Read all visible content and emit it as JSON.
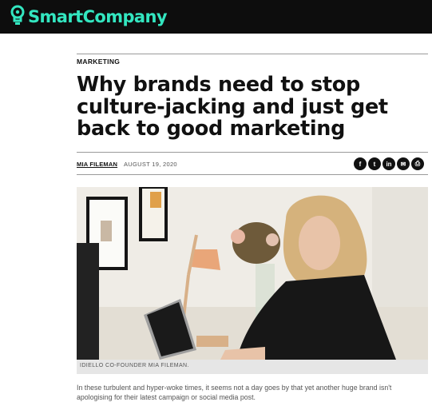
{
  "header": {
    "brand_name": "SmartCompany",
    "brand_color": "#33E6C0",
    "background_color": "#0D0D0D",
    "logo_icon": "lightbulb-icon"
  },
  "article": {
    "category": "MARKETING",
    "headline": "Why brands need to stop culture-jacking and just get back to good marketing",
    "author": "MIA FILEMAN",
    "date": "AUGUST 19, 2020",
    "share_icons": [
      {
        "icon": "facebook-icon",
        "glyph": "f"
      },
      {
        "icon": "twitter-icon",
        "glyph": "t"
      },
      {
        "icon": "linkedin-icon",
        "glyph": "in"
      },
      {
        "icon": "email-icon",
        "glyph": "✉"
      },
      {
        "icon": "print-icon",
        "glyph": "⎙"
      }
    ],
    "image_caption": "IDIELLO CO-FOUNDER MIA FILEMAN.",
    "lede": "In these turbulent and hyper-woke times, it seems not a day goes by that yet another huge brand isn't apologising for their latest campaign or social media post."
  }
}
